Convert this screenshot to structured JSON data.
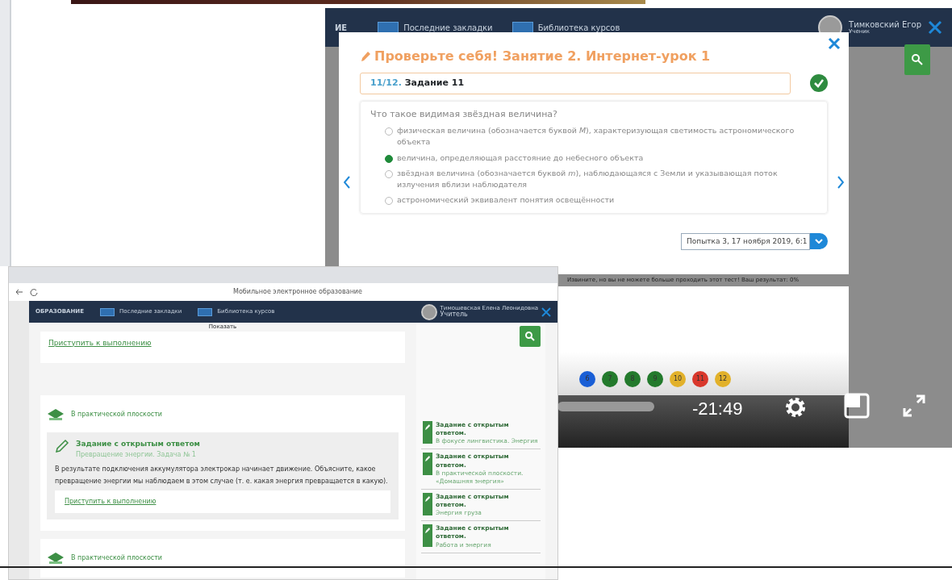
{
  "back_window": {
    "header": {
      "logo": "ИЕ",
      "links": [
        "Последние закладки",
        "Библиотека курсов"
      ],
      "user_name": "Тимковский Егор",
      "user_role": "Ученик"
    },
    "test_modal": {
      "title": "Проверьте себя! Занятие 2. Интернет-урок 1",
      "task_number": "11/12.",
      "task_title": "Задание 11",
      "completed": true,
      "question": "Что такое видимая звёздная величина?",
      "options": [
        {
          "text": "физическая величина (обозначается буквой *M*), характеризующая светимость астрономического объекта",
          "selected": false
        },
        {
          "text": "величина, определяющая расстояние до небесного объекта",
          "selected": true
        },
        {
          "text": "звёздная величина (обозначается буквой *m*), наблюдающаяся с Земли и указывающая поток излучения вблизи наблюдателя",
          "selected": false
        },
        {
          "text": "астрономический эквивалент понятия освещённости",
          "selected": false
        }
      ],
      "attempt": "Попытка 3, 17 ноября 2019, 6:1"
    },
    "message": "Извините, но вы не можете больше проходить этот тест!  Ваш результат: 0%",
    "task_dots": [
      {
        "label": "6",
        "color": "#1a5fd6"
      },
      {
        "label": "7",
        "color": "#237a2c"
      },
      {
        "label": "8",
        "color": "#237a2c"
      },
      {
        "label": "9",
        "color": "#237a2c"
      },
      {
        "label": "10",
        "color": "#e2b12a"
      },
      {
        "label": "11",
        "color": "#d9382c"
      },
      {
        "label": "12",
        "color": "#e2b12a"
      }
    ],
    "video": {
      "time": "-21:49"
    }
  },
  "front_window": {
    "page_title": "Мобильное электронное образование",
    "header": {
      "logo": "ОБРАЗОВАНИЕ",
      "links": [
        "Последние закладки",
        "Библиотека курсов"
      ],
      "user_name": "Тимошевская Елена Леонидовна",
      "user_role": "Учитель"
    },
    "show_label": "Показать",
    "top_link": "Приступить к выполнению",
    "sections": [
      {
        "title": "В практической плоскости",
        "task": {
          "title": "Задание с открытым ответом",
          "subtitle": "Превращение энергии. Задача № 1",
          "text": "В результате подключения аккумулятора электрокар начинает движение. Объясните, какое превращение энергии мы наблюдаем в этом случае (т. е. какая энергия превращается в какую).",
          "link": "Приступить к выполнению"
        }
      },
      {
        "title": "В практической плоскости"
      }
    ],
    "sidebar_items": [
      {
        "title": "Задание с открытым ответом.",
        "subtitle": "В фокусе лингвистика. Энергия"
      },
      {
        "title": "Задание с открытым ответом.",
        "subtitle": "В практической плоскости. «Домашняя энергия»"
      },
      {
        "title": "Задание с открытым ответом.",
        "subtitle": "Энергия груза"
      },
      {
        "title": "Задание с открытым ответом.",
        "subtitle": "Работа и энергия"
      }
    ]
  }
}
